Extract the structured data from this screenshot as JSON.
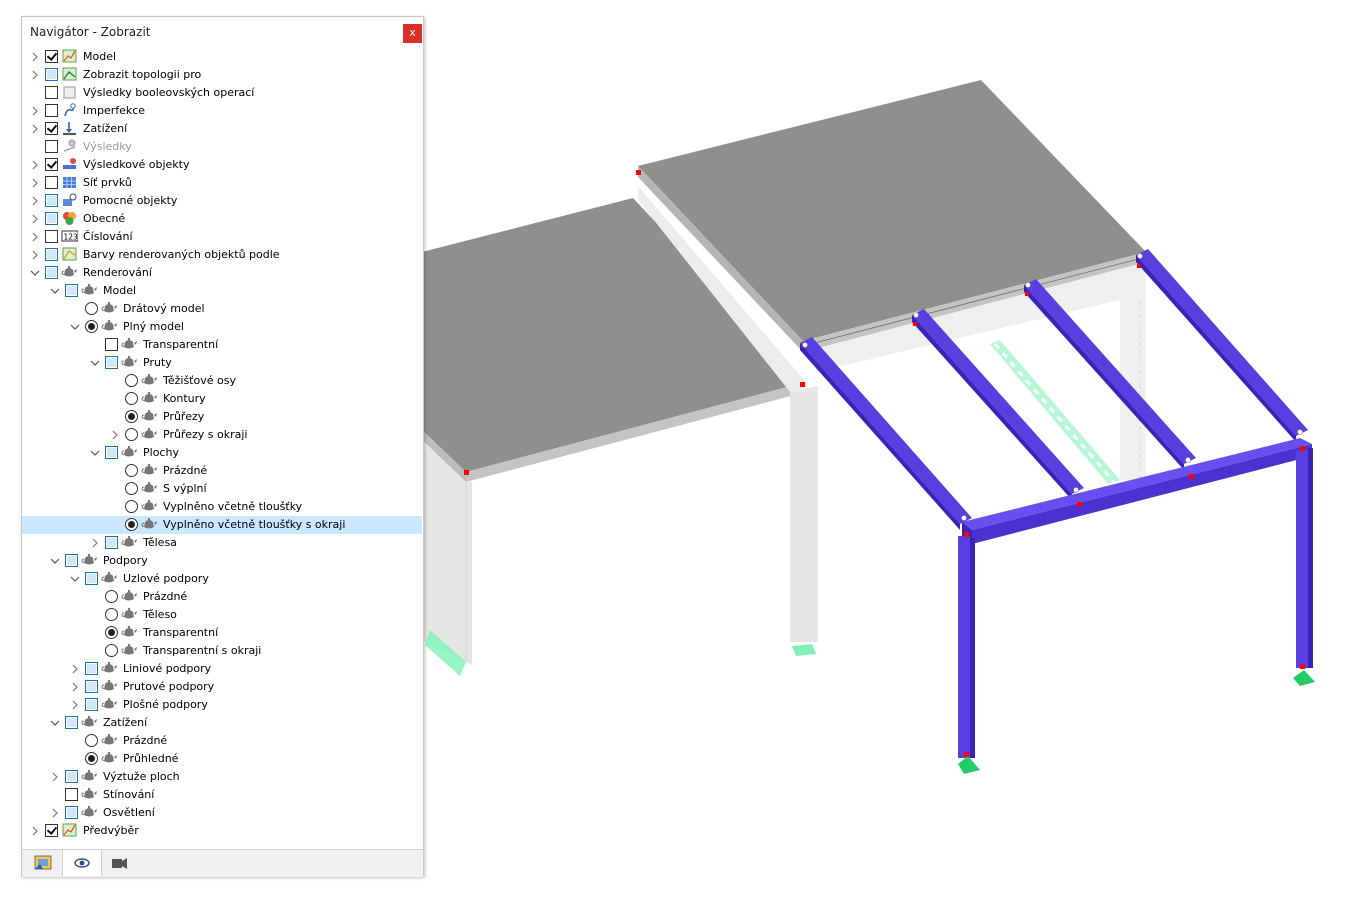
{
  "navigator": {
    "title": "Navigátor - Zobrazit",
    "close_label": "x",
    "tree": [
      {
        "label": "Model",
        "level": 0,
        "exp": "right",
        "ctl": "check-on",
        "icon": "model-icon"
      },
      {
        "label": "Zobrazit topologii pro",
        "level": 0,
        "exp": "right",
        "ctl": "check-partial",
        "icon": "topology-icon"
      },
      {
        "label": "Výsledky booleovských operací",
        "level": 0,
        "exp": "none",
        "ctl": "check-off",
        "icon": "boolean-icon"
      },
      {
        "label": "Imperfekce",
        "level": 0,
        "exp": "right",
        "ctl": "check-off",
        "icon": "imperfection-icon"
      },
      {
        "label": "Zatížení",
        "level": 0,
        "exp": "right",
        "ctl": "check-on",
        "icon": "load-icon"
      },
      {
        "label": "Výsledky",
        "level": 0,
        "exp": "none",
        "ctl": "check-off",
        "icon": "results-icon",
        "dim": true
      },
      {
        "label": "Výsledkové objekty",
        "level": 0,
        "exp": "right",
        "ctl": "check-on",
        "icon": "result-objects-icon"
      },
      {
        "label": "Síť prvků",
        "level": 0,
        "exp": "right",
        "ctl": "check-off",
        "icon": "mesh-icon"
      },
      {
        "label": "Pomocné objekty",
        "level": 0,
        "exp": "right",
        "ctl": "check-partial",
        "icon": "guide-objects-icon"
      },
      {
        "label": "Obecné",
        "level": 0,
        "exp": "right",
        "ctl": "check-partial",
        "icon": "general-icon"
      },
      {
        "label": "Číslování",
        "level": 0,
        "exp": "right",
        "ctl": "check-off",
        "icon": "numbering-icon"
      },
      {
        "label": "Barvy renderovaných objektů podle",
        "level": 0,
        "exp": "right",
        "ctl": "check-partial",
        "icon": "colors-icon"
      },
      {
        "label": "Renderování",
        "level": 0,
        "exp": "down",
        "ctl": "check-partial",
        "icon": "teapot-icon"
      },
      {
        "label": "Model",
        "level": 1,
        "exp": "down",
        "ctl": "check-partial",
        "icon": "teapot-icon"
      },
      {
        "label": "Drátový model",
        "level": 2,
        "exp": "none",
        "ctl": "radio-off",
        "icon": "teapot-icon"
      },
      {
        "label": "Plný model",
        "level": 2,
        "exp": "down",
        "ctl": "radio-on",
        "icon": "teapot-icon"
      },
      {
        "label": "Transparentní",
        "level": 3,
        "exp": "none",
        "ctl": "check-off",
        "icon": "teapot-icon"
      },
      {
        "label": "Pruty",
        "level": 3,
        "exp": "down",
        "ctl": "check-partial",
        "icon": "teapot-icon"
      },
      {
        "label": "Těžišťové osy",
        "level": 4,
        "exp": "none",
        "ctl": "radio-off",
        "icon": "teapot-icon"
      },
      {
        "label": "Kontury",
        "level": 4,
        "exp": "none",
        "ctl": "radio-off",
        "icon": "teapot-icon"
      },
      {
        "label": "Průřezy",
        "level": 4,
        "exp": "none",
        "ctl": "radio-on",
        "icon": "teapot-icon"
      },
      {
        "label": "Průřezy s okraji",
        "level": 4,
        "exp": "right",
        "ctl": "radio-off",
        "icon": "teapot-icon"
      },
      {
        "label": "Plochy",
        "level": 3,
        "exp": "down",
        "ctl": "check-partial",
        "icon": "teapot-icon"
      },
      {
        "label": "Prázdné",
        "level": 4,
        "exp": "none",
        "ctl": "radio-off",
        "icon": "teapot-icon"
      },
      {
        "label": "S výplní",
        "level": 4,
        "exp": "none",
        "ctl": "radio-off",
        "icon": "teapot-icon"
      },
      {
        "label": "Vyplněno včetně tloušťky",
        "level": 4,
        "exp": "none",
        "ctl": "radio-off",
        "icon": "teapot-icon"
      },
      {
        "label": "Vyplněno včetně tloušťky s okraji",
        "level": 4,
        "exp": "none",
        "ctl": "radio-on",
        "icon": "teapot-icon",
        "selected": true
      },
      {
        "label": "Tělesa",
        "level": 3,
        "exp": "right",
        "ctl": "check-partial",
        "icon": "teapot-icon"
      },
      {
        "label": "Podpory",
        "level": 1,
        "exp": "down",
        "ctl": "check-partial",
        "icon": "teapot-icon"
      },
      {
        "label": "Uzlové podpory",
        "level": 2,
        "exp": "down",
        "ctl": "check-partial",
        "icon": "teapot-icon"
      },
      {
        "label": "Prázdné",
        "level": 3,
        "exp": "none",
        "ctl": "radio-off",
        "icon": "teapot-icon"
      },
      {
        "label": "Těleso",
        "level": 3,
        "exp": "none",
        "ctl": "radio-off",
        "icon": "teapot-icon"
      },
      {
        "label": "Transparentní",
        "level": 3,
        "exp": "none",
        "ctl": "radio-on",
        "icon": "teapot-icon"
      },
      {
        "label": "Transparentní s okraji",
        "level": 3,
        "exp": "none",
        "ctl": "radio-off",
        "icon": "teapot-icon"
      },
      {
        "label": "Liniové podpory",
        "level": 2,
        "exp": "right",
        "ctl": "check-partial",
        "icon": "teapot-icon"
      },
      {
        "label": "Prutové podpory",
        "level": 2,
        "exp": "right",
        "ctl": "check-partial",
        "icon": "teapot-icon"
      },
      {
        "label": "Plošné podpory",
        "level": 2,
        "exp": "right",
        "ctl": "check-partial",
        "icon": "teapot-icon"
      },
      {
        "label": "Zatížení",
        "level": 1,
        "exp": "down",
        "ctl": "check-partial",
        "icon": "teapot-icon"
      },
      {
        "label": "Prázdné",
        "level": 2,
        "exp": "none",
        "ctl": "radio-off",
        "icon": "teapot-icon"
      },
      {
        "label": "Průhledné",
        "level": 2,
        "exp": "none",
        "ctl": "radio-on",
        "icon": "teapot-icon"
      },
      {
        "label": "Výztuže ploch",
        "level": 1,
        "exp": "right",
        "ctl": "check-partial",
        "icon": "teapot-icon"
      },
      {
        "label": "Stínování",
        "level": 1,
        "exp": "none",
        "ctl": "check-off",
        "icon": "teapot-icon"
      },
      {
        "label": "Osvětlení",
        "level": 1,
        "exp": "right",
        "ctl": "check-partial",
        "icon": "teapot-icon"
      },
      {
        "label": "Předvýběr",
        "level": 0,
        "exp": "right",
        "ctl": "check-on",
        "icon": "model-icon"
      }
    ],
    "tabs": [
      {
        "name": "data-tab",
        "icon": "data-icon",
        "active": false
      },
      {
        "name": "display-tab",
        "icon": "eye-icon",
        "active": true
      },
      {
        "name": "views-tab",
        "icon": "camera-icon",
        "active": false
      }
    ]
  },
  "colors": {
    "beam": "#5a3fe0",
    "beam_dark": "#3b22b8",
    "slab_top": "#8f8f8e",
    "slab_edge": "#b5b5b3",
    "column": "#e6e6e4",
    "node": "#ff0000",
    "support": "#22cc66",
    "support_ghost": "#7ef2b6",
    "selection": "#cce8ff",
    "close_button": "#d9302a"
  }
}
